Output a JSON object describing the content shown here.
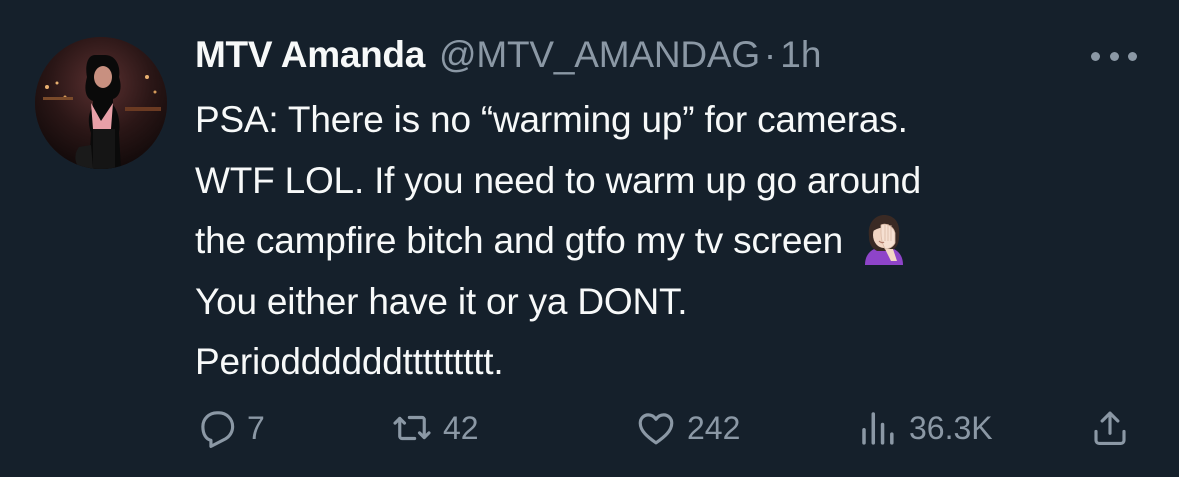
{
  "tweet": {
    "author": {
      "display_name": "MTV Amanda",
      "handle": "@MTV_AMANDAG",
      "separator": "·",
      "time": "1h"
    },
    "text_lines": [
      "PSA: There is no “warming up” for cameras.",
      "WTF LOL. If you need to warm up go around",
      "the campfire bitch and gtfo my tv screen",
      "You either have it or ya DONT.",
      "Perioddddddttttttttt."
    ],
    "emoji": "face-palm-woman",
    "actions": {
      "replies": "7",
      "retweets": "42",
      "likes": "242",
      "views": "36.3K"
    }
  },
  "icons": {
    "reply": "reply-icon",
    "retweet": "retweet-icon",
    "like": "heart-icon",
    "views": "views-icon",
    "share": "share-icon",
    "more": "more-icon"
  },
  "colors": {
    "background": "#15202b",
    "primary_text": "#f7f9f9",
    "secondary_text": "#8b98a5"
  }
}
